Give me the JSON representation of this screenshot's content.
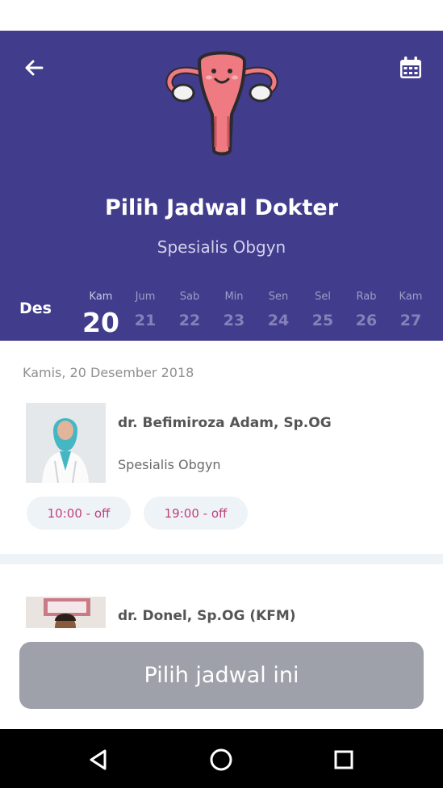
{
  "header": {
    "title": "Pilih Jadwal Dokter",
    "subtitle": "Spesialis Obgyn"
  },
  "calendar": {
    "month": "Des",
    "days": [
      {
        "dow": "Kam",
        "num": "20",
        "active": true
      },
      {
        "dow": "Jum",
        "num": "21"
      },
      {
        "dow": "Sab",
        "num": "22"
      },
      {
        "dow": "Min",
        "num": "23"
      },
      {
        "dow": "Sen",
        "num": "24"
      },
      {
        "dow": "Sel",
        "num": "25"
      },
      {
        "dow": "Rab",
        "num": "26"
      },
      {
        "dow": "Kam",
        "num": "27"
      }
    ]
  },
  "schedule": {
    "date_heading": "Kamis, 20 Desember 2018",
    "doctors": [
      {
        "name": "dr. Befimiroza Adam, Sp.OG",
        "specialty": "Spesialis Obgyn",
        "slots": [
          "10:00 - off",
          "19:00 - off"
        ]
      },
      {
        "name": "dr. Donel, Sp.OG (KFM)"
      }
    ]
  },
  "action": {
    "select_label": "Pilih jadwal ini"
  },
  "colors": {
    "primary": "#413c8c",
    "slot_text": "#c2417a",
    "slot_bg": "#eef3f8",
    "button_disabled": "#9fa1aa"
  },
  "icons": {
    "back": "arrow-left-icon",
    "calendar": "calendar-icon",
    "illustration": "uterus-illustration",
    "nav_back": "triangle-back-icon",
    "nav_home": "circle-home-icon",
    "nav_recents": "square-recents-icon"
  }
}
